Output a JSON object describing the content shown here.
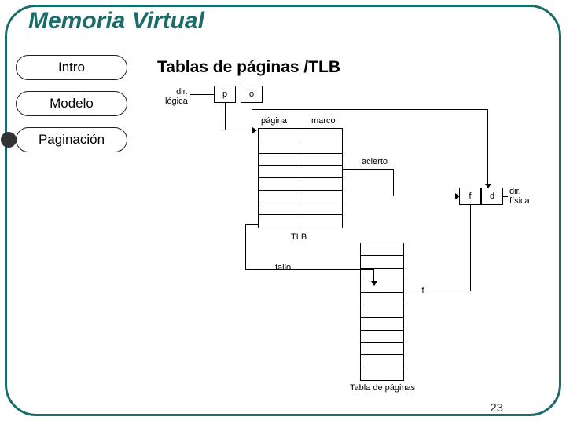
{
  "title": "Memoria Virtual",
  "nav": {
    "items": [
      {
        "label": "Intro",
        "active": false
      },
      {
        "label": "Modelo",
        "active": false
      },
      {
        "label": "Paginación",
        "active": true
      }
    ]
  },
  "content": {
    "heading": "Tablas de páginas /TLB"
  },
  "diagram": {
    "dir_logica": "dir.\nlógica",
    "p": "p",
    "o": "o",
    "pagina": "página",
    "marco": "marco",
    "acierto": "acierto",
    "f": "f",
    "d": "d",
    "dir_fisica": "dir.\nfísica",
    "tlb": "TLB",
    "fallo": "fallo",
    "f2": "f",
    "tabla": "Tabla de páginas"
  },
  "pagenum": "23"
}
